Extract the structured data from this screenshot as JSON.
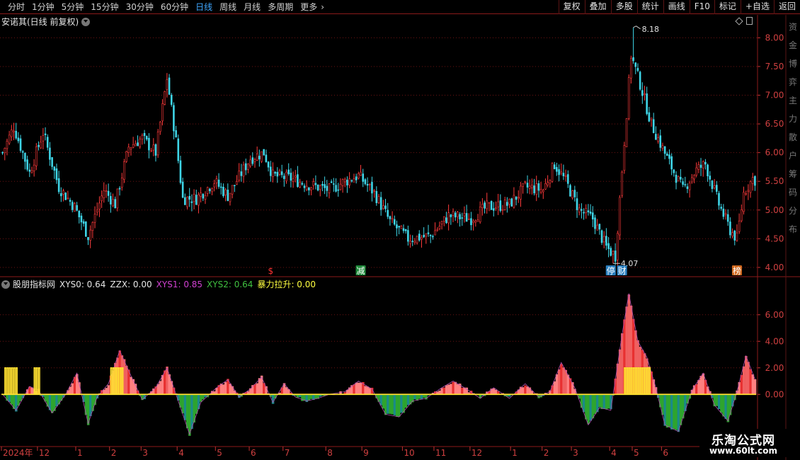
{
  "toolbar": {
    "periods": [
      {
        "label": "分时",
        "active": false
      },
      {
        "label": "1分钟",
        "active": false
      },
      {
        "label": "5分钟",
        "active": false
      },
      {
        "label": "15分钟",
        "active": false
      },
      {
        "label": "30分钟",
        "active": false
      },
      {
        "label": "60分钟",
        "active": false
      },
      {
        "label": "日线",
        "active": true
      },
      {
        "label": "周线",
        "active": false
      },
      {
        "label": "月线",
        "active": false
      },
      {
        "label": "多周期",
        "active": false
      },
      {
        "label": "更多",
        "active": false
      }
    ],
    "more_chevron": "›",
    "tools": [
      "复权",
      "叠加",
      "多股",
      "统计",
      "画线",
      "F10",
      "标记",
      "+自选",
      "返回"
    ]
  },
  "main_chart": {
    "title": "安诺其(日线 前复权)",
    "price_labels": [
      "8.00",
      "7.50",
      "7.00",
      "6.50",
      "6.00",
      "5.50",
      "5.00",
      "4.50",
      "4.00"
    ],
    "price_values": [
      8.0,
      7.5,
      7.0,
      6.5,
      6.0,
      5.5,
      5.0,
      4.5,
      4.0
    ],
    "high_marker": "8.18",
    "low_marker": "4.07",
    "event_badges": [
      {
        "label": "$",
        "color": "#ff3333",
        "bg": "none",
        "index": 119
      },
      {
        "label": "减",
        "color": "#ffffff",
        "bg": "#1f8a3a",
        "index": 159
      },
      {
        "label": "停",
        "color": "#ffffff",
        "bg": "#2a7fbf",
        "index": 270
      },
      {
        "label": "财",
        "color": "#ffffff",
        "bg": "#2a7fbf",
        "index": 275
      },
      {
        "label": "榜",
        "color": "#ffffff",
        "bg": "#d2691e",
        "index": 326
      }
    ]
  },
  "indicator": {
    "name": "股朋指标网",
    "items": [
      {
        "label": "XYS0: 0.64",
        "color": "#e6e6e6"
      },
      {
        "label": "ZZX: 0.00",
        "color": "#e6e6e6"
      },
      {
        "label": "XYS1: 0.85",
        "color": "#d040d0"
      },
      {
        "label": "XYS2: 0.64",
        "color": "#40c040"
      },
      {
        "label": "暴力拉升: 0.00",
        "color": "#ffff40"
      }
    ],
    "axis_labels": [
      "6.00",
      "4.00",
      "2.00",
      "0.00"
    ],
    "axis_values": [
      6,
      4,
      2,
      0
    ]
  },
  "time_axis": {
    "labels": [
      {
        "text": "2024年",
        "index": 0
      },
      {
        "text": "12",
        "index": 16
      },
      {
        "text": "1",
        "index": 33
      },
      {
        "text": "2",
        "index": 48
      },
      {
        "text": "3",
        "index": 62
      },
      {
        "text": "4",
        "index": 78
      },
      {
        "text": "5",
        "index": 95
      },
      {
        "text": "6",
        "index": 110
      },
      {
        "text": "7",
        "index": 125
      },
      {
        "text": "8",
        "index": 144
      },
      {
        "text": "9",
        "index": 160
      },
      {
        "text": "10",
        "index": 178
      },
      {
        "text": "11",
        "index": 192
      },
      {
        "text": "12",
        "index": 208
      },
      {
        "text": "1",
        "index": 226
      },
      {
        "text": "2",
        "index": 240
      },
      {
        "text": "3",
        "index": 253
      },
      {
        "text": "4",
        "index": 270
      },
      {
        "text": "5",
        "index": 280
      },
      {
        "text": "6",
        "index": 293
      }
    ]
  },
  "chart_data": {
    "type": "candlestick",
    "title": "安诺其(日线 前复权)",
    "y_range": [
      3.9,
      8.35
    ],
    "bars": 335,
    "anchors": [
      [
        0,
        6.0
      ],
      [
        5,
        6.45
      ],
      [
        12,
        5.65
      ],
      [
        18,
        6.35
      ],
      [
        25,
        5.4
      ],
      [
        32,
        5.05
      ],
      [
        38,
        4.55
      ],
      [
        45,
        5.35
      ],
      [
        50,
        5.1
      ],
      [
        56,
        6.1
      ],
      [
        62,
        6.25
      ],
      [
        68,
        6.0
      ],
      [
        73,
        7.3
      ],
      [
        77,
        6.2
      ],
      [
        80,
        5.2
      ],
      [
        86,
        5.2
      ],
      [
        94,
        5.5
      ],
      [
        100,
        5.25
      ],
      [
        110,
        5.9
      ],
      [
        116,
        6.0
      ],
      [
        120,
        5.6
      ],
      [
        128,
        5.55
      ],
      [
        135,
        5.45
      ],
      [
        145,
        5.35
      ],
      [
        152,
        5.5
      ],
      [
        158,
        5.6
      ],
      [
        165,
        5.3
      ],
      [
        172,
        4.8
      ],
      [
        180,
        4.5
      ],
      [
        190,
        4.55
      ],
      [
        198,
        4.9
      ],
      [
        208,
        4.85
      ],
      [
        215,
        5.05
      ],
      [
        225,
        5.1
      ],
      [
        232,
        5.4
      ],
      [
        240,
        5.35
      ],
      [
        245,
        5.8
      ],
      [
        250,
        5.5
      ],
      [
        256,
        5.0
      ],
      [
        262,
        4.85
      ],
      [
        268,
        4.35
      ],
      [
        272,
        4.2
      ],
      [
        276,
        6.2
      ],
      [
        279,
        7.7
      ],
      [
        283,
        7.2
      ],
      [
        288,
        6.5
      ],
      [
        295,
        5.9
      ],
      [
        302,
        5.35
      ],
      [
        308,
        5.7
      ],
      [
        312,
        5.8
      ],
      [
        318,
        5.1
      ],
      [
        323,
        4.65
      ],
      [
        326,
        4.5
      ],
      [
        329,
        5.3
      ],
      [
        333,
        5.55
      ],
      [
        335,
        5.5
      ]
    ],
    "high_point": {
      "index": 280,
      "value": 8.18
    },
    "low_point": {
      "index": 271,
      "value": 4.07
    },
    "indicator": {
      "type": "area",
      "name": "股朋指标网",
      "y_range": [
        -3.4,
        7.8
      ],
      "anchors": [
        [
          0,
          0.0
        ],
        [
          6,
          -1.2
        ],
        [
          12,
          0.6
        ],
        [
          16,
          0.3
        ],
        [
          22,
          -1.4
        ],
        [
          28,
          0.0
        ],
        [
          33,
          1.6
        ],
        [
          38,
          -2.2
        ],
        [
          42,
          -0.2
        ],
        [
          47,
          0.8
        ],
        [
          52,
          3.3
        ],
        [
          57,
          1.4
        ],
        [
          62,
          -0.4
        ],
        [
          68,
          0.5
        ],
        [
          73,
          2.0
        ],
        [
          78,
          -0.5
        ],
        [
          83,
          -3.0
        ],
        [
          88,
          -0.6
        ],
        [
          95,
          0.5
        ],
        [
          100,
          1.1
        ],
        [
          105,
          -0.2
        ],
        [
          110,
          0.4
        ],
        [
          115,
          1.3
        ],
        [
          120,
          -0.6
        ],
        [
          125,
          0.8
        ],
        [
          130,
          -0.2
        ],
        [
          135,
          -0.5
        ],
        [
          140,
          -0.3
        ],
        [
          145,
          0.0
        ],
        [
          152,
          0.2
        ],
        [
          158,
          1.0
        ],
        [
          164,
          0.4
        ],
        [
          170,
          -1.5
        ],
        [
          176,
          -1.7
        ],
        [
          182,
          -0.5
        ],
        [
          188,
          -0.3
        ],
        [
          195,
          0.5
        ],
        [
          200,
          1.0
        ],
        [
          206,
          0.4
        ],
        [
          212,
          -0.3
        ],
        [
          218,
          0.5
        ],
        [
          225,
          -0.3
        ],
        [
          232,
          0.8
        ],
        [
          238,
          -0.2
        ],
        [
          243,
          0.2
        ],
        [
          248,
          2.4
        ],
        [
          254,
          0.5
        ],
        [
          260,
          -2.3
        ],
        [
          265,
          -1.0
        ],
        [
          270,
          -1.2
        ],
        [
          275,
          4.5
        ],
        [
          278,
          7.6
        ],
        [
          282,
          4.0
        ],
        [
          286,
          2.8
        ],
        [
          290,
          0.5
        ],
        [
          294,
          -2.3
        ],
        [
          300,
          -2.8
        ],
        [
          306,
          0.3
        ],
        [
          311,
          1.6
        ],
        [
          316,
          -0.8
        ],
        [
          322,
          -2.0
        ],
        [
          326,
          0.2
        ],
        [
          330,
          2.9
        ],
        [
          335,
          0.7
        ]
      ],
      "spikes": [
        {
          "from": 1,
          "to": 6,
          "value": 2.0
        },
        {
          "from": 14,
          "to": 16,
          "value": 2.0
        },
        {
          "from": 48,
          "to": 53,
          "value": 2.0
        },
        {
          "from": 276,
          "to": 287,
          "value": 2.0
        }
      ]
    }
  },
  "watermark": {
    "title": "乐淘公式网",
    "url": "www.60lt.com"
  },
  "right_strip": {
    "chars": [
      "资",
      "金",
      "博",
      "弈",
      "主",
      "力",
      "散",
      "户",
      "筹",
      "码",
      "分",
      "布"
    ]
  }
}
